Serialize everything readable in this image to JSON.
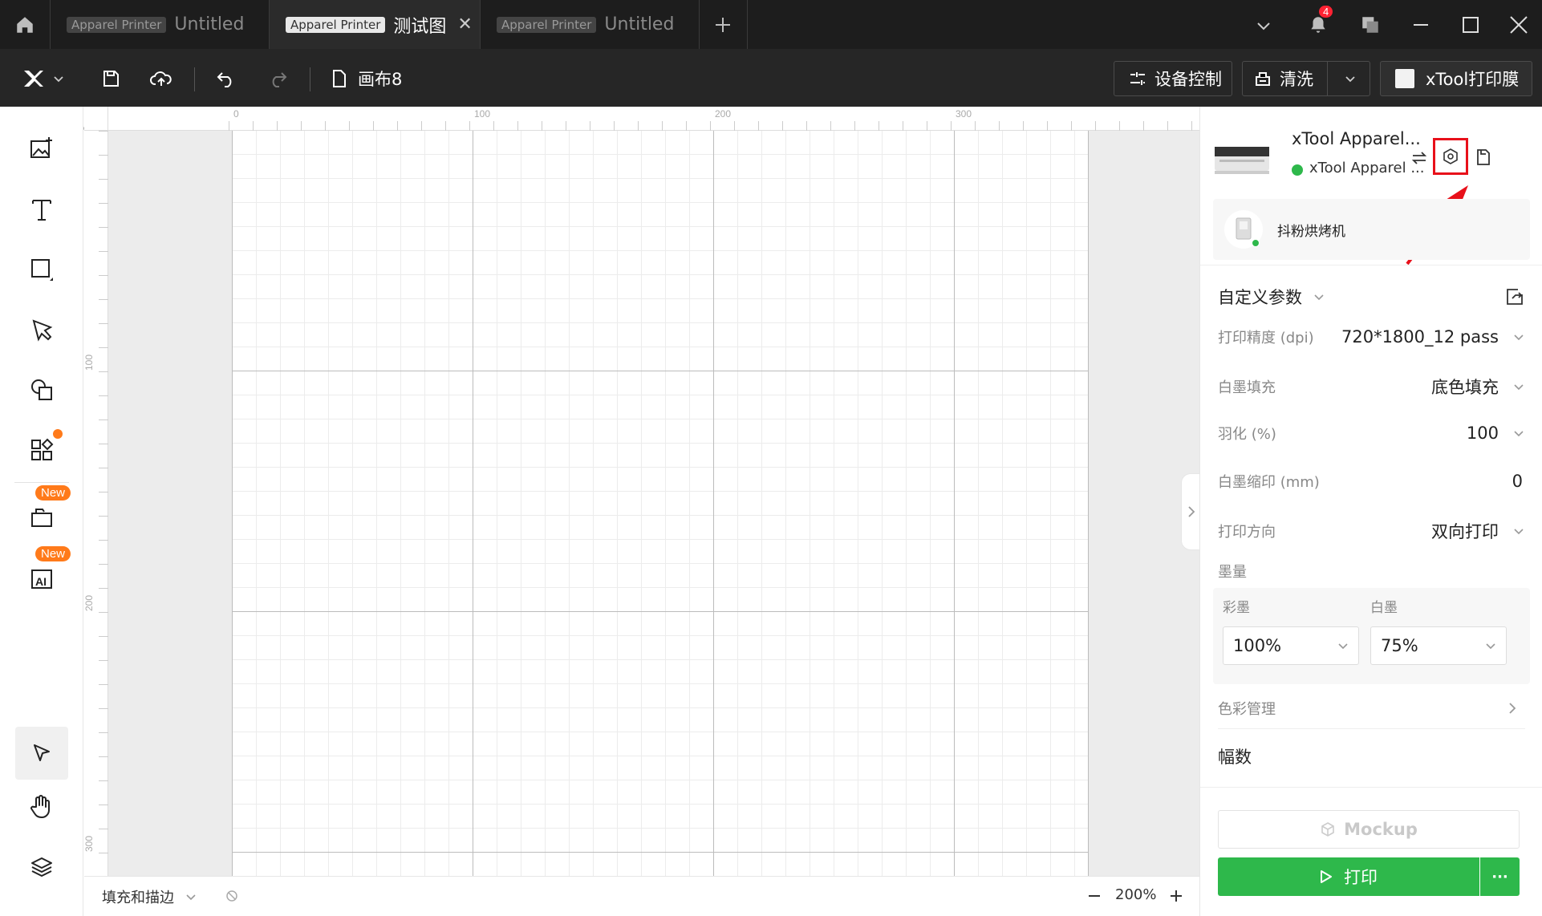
{
  "titlebar": {
    "tabs": [
      {
        "badge": "Apparel Printer",
        "title": "Untitled",
        "active": false
      },
      {
        "badge": "Apparel Printer",
        "title": "测试图",
        "active": true
      },
      {
        "badge": "Apparel Printer",
        "title": "Untitled",
        "active": false
      }
    ],
    "notification_count": "4"
  },
  "toolbar": {
    "canvas_name": "画布8",
    "device_control": "设备控制",
    "clean": "清洗",
    "material": "xTool打印膜"
  },
  "leftbar": {
    "new_badge_1": "New",
    "new_badge_2": "New"
  },
  "canvas": {
    "ruler_top": [
      "0",
      "100",
      "200",
      "300"
    ],
    "ruler_left": [
      "0",
      "100",
      "200",
      "300"
    ]
  },
  "bottombar": {
    "fill_stroke": "填充和描边",
    "zoom": "200%"
  },
  "device": {
    "name": "xTool Apparel...",
    "connection": "xTool Apparel ...",
    "accessory": "抖粉烘烤机"
  },
  "params": {
    "section_title": "自定义参数",
    "rows": [
      {
        "label": "打印精度 (dpi)",
        "value": "720*1800_12 pass"
      },
      {
        "label": "白墨填充",
        "value": "底色填充"
      },
      {
        "label": "羽化 (%)",
        "value": "100"
      },
      {
        "label": "白墨缩印 (mm)",
        "value": "0"
      },
      {
        "label": "打印方向",
        "value": "双向打印"
      }
    ],
    "ink_title": "墨量",
    "color_ink_label": "彩墨",
    "color_ink_value": "100%",
    "white_ink_label": "白墨",
    "white_ink_value": "75%",
    "color_mgmt": "色彩管理",
    "copies": "幅数"
  },
  "actions": {
    "mockup": "Mockup",
    "print": "打印",
    "more": "···"
  },
  "colors": {
    "accent_green": "#2eb84b",
    "highlight_red": "#e8101a",
    "badge_orange": "#ff7a1a"
  }
}
